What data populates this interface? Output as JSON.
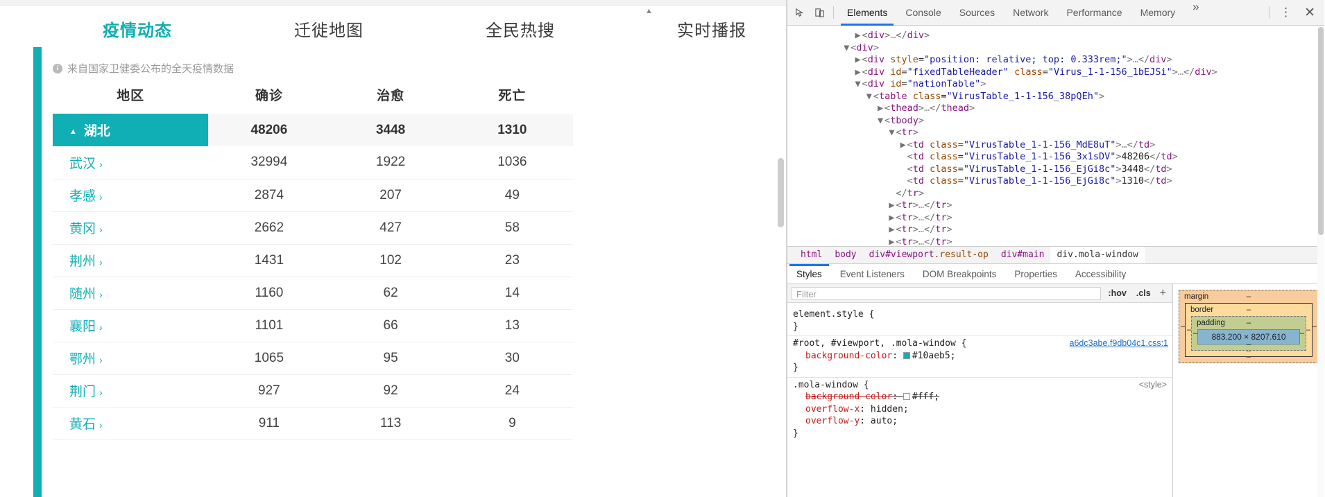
{
  "webpage": {
    "tabs": [
      {
        "label": "疫情动态",
        "active": true
      },
      {
        "label": "迁徙地图",
        "active": false
      },
      {
        "label": "全民热搜",
        "active": false
      },
      {
        "label": "实时播报",
        "active": false
      }
    ],
    "source_note": "来自国家卫健委公布的全天疫情数据",
    "info_icon": "info-icon",
    "table": {
      "headers": [
        "地区",
        "确诊",
        "治愈",
        "死亡"
      ],
      "province": {
        "name": "湖北",
        "caret": "▲",
        "confirmed": "48206",
        "cured": "3448",
        "deaths": "1310"
      },
      "cities": [
        {
          "name": "武汉",
          "chevron": "›",
          "confirmed": "32994",
          "cured": "1922",
          "deaths": "1036"
        },
        {
          "name": "孝感",
          "chevron": "›",
          "confirmed": "2874",
          "cured": "207",
          "deaths": "49"
        },
        {
          "name": "黄冈",
          "chevron": "›",
          "confirmed": "2662",
          "cured": "427",
          "deaths": "58"
        },
        {
          "name": "荆州",
          "chevron": "›",
          "confirmed": "1431",
          "cured": "102",
          "deaths": "23"
        },
        {
          "name": "随州",
          "chevron": "›",
          "confirmed": "1160",
          "cured": "62",
          "deaths": "14"
        },
        {
          "name": "襄阳",
          "chevron": "›",
          "confirmed": "1101",
          "cured": "66",
          "deaths": "13"
        },
        {
          "name": "鄂州",
          "chevron": "›",
          "confirmed": "1065",
          "cured": "95",
          "deaths": "30"
        },
        {
          "name": "荆门",
          "chevron": "›",
          "confirmed": "927",
          "cured": "92",
          "deaths": "24"
        },
        {
          "name": "黄石",
          "chevron": "›",
          "confirmed": "911",
          "cured": "113",
          "deaths": "9"
        }
      ]
    },
    "accent_color": "#10aeb5"
  },
  "devtools": {
    "toolbar": {
      "inspect_icon": "inspect-element-icon",
      "device_icon": "device-toolbar-icon",
      "tabs": [
        {
          "label": "Elements",
          "active": true
        },
        {
          "label": "Console",
          "active": false
        },
        {
          "label": "Sources",
          "active": false
        },
        {
          "label": "Network",
          "active": false
        },
        {
          "label": "Performance",
          "active": false
        },
        {
          "label": "Memory",
          "active": false
        }
      ],
      "more_tabs": "»",
      "menu_icon": "⋮",
      "close_icon": "✕"
    },
    "dom_lines": [
      {
        "indent": 6,
        "arrow": "▶",
        "html": "<span class='pn'>&lt;</span><span class='tw'>div</span><span class='pn'>&gt;</span><span class='ell'>…</span><span class='pn'>&lt;/</span><span class='tw'>div</span><span class='pn'>&gt;</span>"
      },
      {
        "indent": 5,
        "arrow": "▼",
        "html": "<span class='pn'>&lt;</span><span class='tw'>div</span><span class='pn'>&gt;</span>"
      },
      {
        "indent": 6,
        "arrow": "▶",
        "html": "<span class='pn'>&lt;</span><span class='tw'>div</span> <span class='at'>style</span>=<span class='av'>\"position: relative; top: 0.333rem;\"</span><span class='pn'>&gt;</span><span class='ell'>…</span><span class='pn'>&lt;/</span><span class='tw'>div</span><span class='pn'>&gt;</span>"
      },
      {
        "indent": 6,
        "arrow": "▶",
        "html": "<span class='pn'>&lt;</span><span class='tw'>div</span> <span class='at'>id</span>=<span class='av'>\"fixedTableHeader\"</span> <span class='at'>class</span>=<span class='av'>\"Virus_1-1-156_1bEJSi\"</span><span class='pn'>&gt;</span><span class='ell'>…</span><span class='pn'>&lt;/</span><span class='tw'>div</span><span class='pn'>&gt;</span>"
      },
      {
        "indent": 6,
        "arrow": "▼",
        "html": "<span class='pn'>&lt;</span><span class='tw'>div</span> <span class='at'>id</span>=<span class='av'>\"nationTable\"</span><span class='pn'>&gt;</span>"
      },
      {
        "indent": 7,
        "arrow": "▼",
        "html": "<span class='pn'>&lt;</span><span class='tw'>table</span> <span class='at'>class</span>=<span class='av'>\"VirusTable_1-1-156_38pQEh\"</span><span class='pn'>&gt;</span>"
      },
      {
        "indent": 8,
        "arrow": "▶",
        "html": "<span class='pn'>&lt;</span><span class='tw'>thead</span><span class='pn'>&gt;</span><span class='ell'>…</span><span class='pn'>&lt;/</span><span class='tw'>thead</span><span class='pn'>&gt;</span>"
      },
      {
        "indent": 8,
        "arrow": "▼",
        "html": "<span class='pn'>&lt;</span><span class='tw'>tbody</span><span class='pn'>&gt;</span>"
      },
      {
        "indent": 9,
        "arrow": "▼",
        "html": "<span class='pn'>&lt;</span><span class='tw'>tr</span><span class='pn'>&gt;</span>"
      },
      {
        "indent": 10,
        "arrow": "▶",
        "html": "<span class='pn'>&lt;</span><span class='tw'>td</span> <span class='at'>class</span>=<span class='av'>\"VirusTable_1-1-156_MdE8uT\"</span><span class='pn'>&gt;</span><span class='ell'>…</span><span class='pn'>&lt;/</span><span class='tw'>td</span><span class='pn'>&gt;</span>"
      },
      {
        "indent": 10,
        "arrow": "",
        "html": "<span class='pn'>&lt;</span><span class='tw'>td</span> <span class='at'>class</span>=<span class='av'>\"VirusTable_1-1-156_3x1sDV\"</span><span class='pn'>&gt;</span><span class='tx'>48206</span><span class='pn'>&lt;/</span><span class='tw'>td</span><span class='pn'>&gt;</span>"
      },
      {
        "indent": 10,
        "arrow": "",
        "html": "<span class='pn'>&lt;</span><span class='tw'>td</span> <span class='at'>class</span>=<span class='av'>\"VirusTable_1-1-156_EjGi8c\"</span><span class='pn'>&gt;</span><span class='tx'>3448</span><span class='pn'>&lt;/</span><span class='tw'>td</span><span class='pn'>&gt;</span>"
      },
      {
        "indent": 10,
        "arrow": "",
        "html": "<span class='pn'>&lt;</span><span class='tw'>td</span> <span class='at'>class</span>=<span class='av'>\"VirusTable_1-1-156_EjGi8c\"</span><span class='pn'>&gt;</span><span class='tx'>1310</span><span class='pn'>&lt;/</span><span class='tw'>td</span><span class='pn'>&gt;</span>"
      },
      {
        "indent": 9,
        "arrow": "",
        "html": "<span class='pn'>&lt;/</span><span class='tw'>tr</span><span class='pn'>&gt;</span>"
      },
      {
        "indent": 9,
        "arrow": "▶",
        "html": "<span class='pn'>&lt;</span><span class='tw'>tr</span><span class='pn'>&gt;</span><span class='ell'>…</span><span class='pn'>&lt;/</span><span class='tw'>tr</span><span class='pn'>&gt;</span>"
      },
      {
        "indent": 9,
        "arrow": "▶",
        "html": "<span class='pn'>&lt;</span><span class='tw'>tr</span><span class='pn'>&gt;</span><span class='ell'>…</span><span class='pn'>&lt;/</span><span class='tw'>tr</span><span class='pn'>&gt;</span>"
      },
      {
        "indent": 9,
        "arrow": "▶",
        "html": "<span class='pn'>&lt;</span><span class='tw'>tr</span><span class='pn'>&gt;</span><span class='ell'>…</span><span class='pn'>&lt;/</span><span class='tw'>tr</span><span class='pn'>&gt;</span>"
      },
      {
        "indent": 9,
        "arrow": "▶",
        "html": "<span class='pn'>&lt;</span><span class='tw'>tr</span><span class='pn'>&gt;</span><span class='ell'>…</span><span class='pn'>&lt;/</span><span class='tw'>tr</span><span class='pn'>&gt;</span>"
      }
    ],
    "breadcrumb": [
      {
        "label": "html",
        "selected": false
      },
      {
        "label": "body",
        "selected": false
      },
      {
        "label": "div#viewport",
        "suffix": ".result-op",
        "selected": false
      },
      {
        "label": "div#main",
        "selected": false
      },
      {
        "label": "div.mola-window",
        "selected": true
      }
    ],
    "styles_tabs": [
      {
        "label": "Styles",
        "active": true
      },
      {
        "label": "Event Listeners",
        "active": false
      },
      {
        "label": "DOM Breakpoints",
        "active": false
      },
      {
        "label": "Properties",
        "active": false
      },
      {
        "label": "Accessibility",
        "active": false
      }
    ],
    "filter": {
      "placeholder": "Filter",
      "value": "",
      "hov_label": ":hov",
      "cls_label": ".cls",
      "plus_label": "+"
    },
    "css_rules": [
      {
        "selector": "element.style {",
        "close": "}",
        "source": "",
        "declarations": []
      },
      {
        "selector": "#root, #viewport, .mola-window {",
        "close": "}",
        "source": "a6dc3abe.f9db04c1.css:1",
        "declarations": [
          {
            "property": "background-color",
            "value": "#10aeb5",
            "swatch": "#10aeb5",
            "struck": false
          }
        ]
      },
      {
        "selector": ".mola-window {",
        "close": "}",
        "source": "<style>",
        "declarations": [
          {
            "property": "background-color",
            "value": "#fff",
            "swatch": "#ffffff",
            "struck": true
          },
          {
            "property": "overflow-x",
            "value": "hidden",
            "struck": false
          },
          {
            "property": "overflow-y",
            "value": "auto",
            "struck": false
          }
        ]
      }
    ],
    "box_model": {
      "margin_label": "margin",
      "border_label": "border",
      "padding_label": "padding",
      "content_size": "883.200 × 8207.610",
      "dash": "–"
    }
  }
}
